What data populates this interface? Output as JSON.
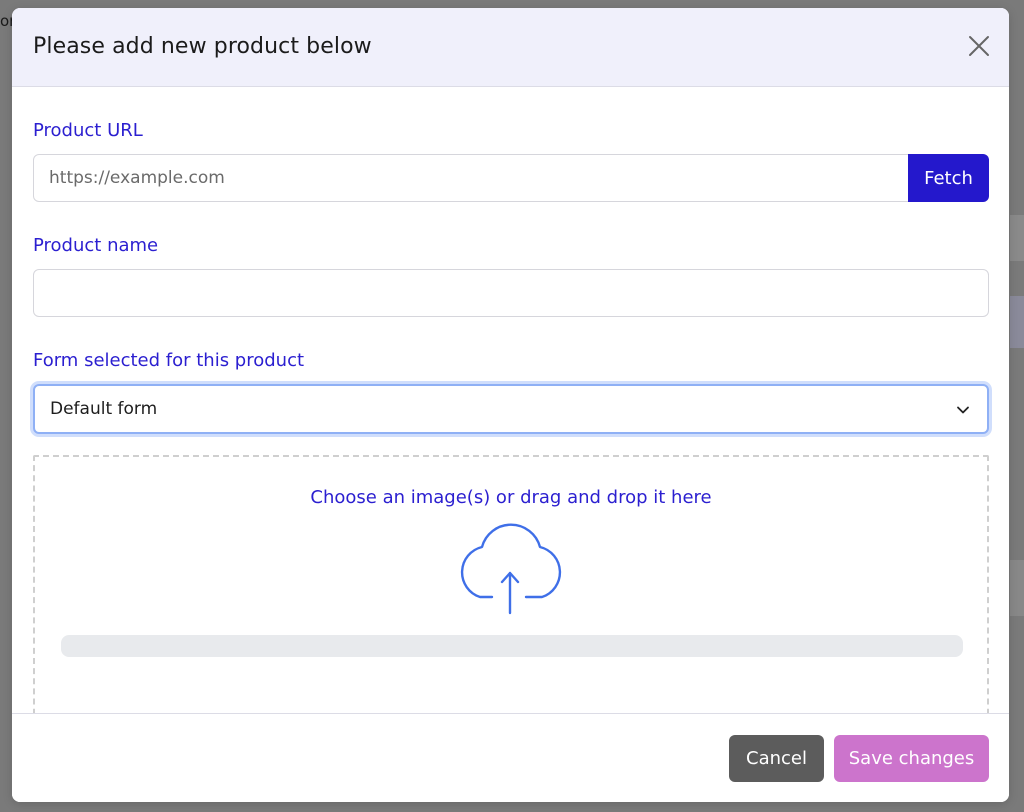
{
  "background": {
    "edge_text": "or"
  },
  "modal": {
    "title": "Please add new product below",
    "close_icon": "close-icon"
  },
  "form": {
    "product_url": {
      "label": "Product URL",
      "placeholder": "https://example.com",
      "value": ""
    },
    "fetch_label": "Fetch",
    "product_name": {
      "label": "Product name",
      "value": ""
    },
    "form_select": {
      "label": "Form selected for this product",
      "selected": "Default form"
    },
    "dropzone": {
      "text": "Choose an image(s) or drag and drop it here",
      "icon": "cloud-upload-icon",
      "progress": 0
    }
  },
  "footer": {
    "cancel_label": "Cancel",
    "save_label": "Save changes"
  },
  "colors": {
    "accent": "#2418cc",
    "label": "#2b1fd0",
    "save": "#cc74cc",
    "cancel": "#5c5c5c",
    "icon": "#3f6fe8"
  }
}
